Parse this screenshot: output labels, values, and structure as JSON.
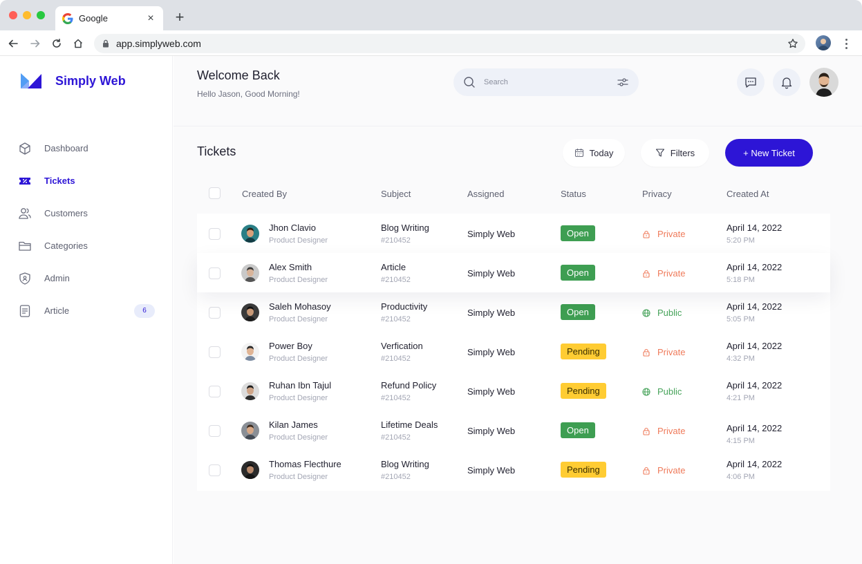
{
  "browser": {
    "tab_title": "Google",
    "tab_close": "×",
    "new_tab": "+",
    "url": "app.simplyweb.com"
  },
  "brand": {
    "name": "Simply Web"
  },
  "sidebar": {
    "items": [
      {
        "label": "Dashboard",
        "icon": "box-icon",
        "active": false
      },
      {
        "label": "Tickets",
        "icon": "ticket-icon",
        "active": true
      },
      {
        "label": "Customers",
        "icon": "users-icon",
        "active": false
      },
      {
        "label": "Categories",
        "icon": "folder-icon",
        "active": false
      },
      {
        "label": "Admin",
        "icon": "shield-user-icon",
        "active": false
      },
      {
        "label": "Article",
        "icon": "document-icon",
        "active": false,
        "badge": "6"
      }
    ]
  },
  "header": {
    "title": "Welcome Back",
    "greeting": "Hello Jason, Good Morning!",
    "search_placeholder": "Search"
  },
  "tickets": {
    "title": "Tickets",
    "today_label": "Today",
    "filters_label": "Filters",
    "new_ticket_label": "+ New Ticket",
    "columns": {
      "created_by": "Created By",
      "subject": "Subject",
      "assigned": "Assigned",
      "status": "Status",
      "privacy": "Privacy",
      "created_at": "Created At"
    },
    "rows": [
      {
        "name": "Jhon Clavio",
        "role": "Product Designer",
        "subject": "Blog Writing",
        "id": "#210452",
        "assigned": "Simply Web",
        "status": "Open",
        "privacy": "Private",
        "date": "April 14, 2022",
        "time": "5:20 PM"
      },
      {
        "name": "Alex Smith",
        "role": "Product Designer",
        "subject": "Article",
        "id": "#210452",
        "assigned": "Simply Web",
        "status": "Open",
        "privacy": "Private",
        "date": "April 14, 2022",
        "time": "5:18 PM"
      },
      {
        "name": "Saleh Mohasoy",
        "role": "Product Designer",
        "subject": "Productivity",
        "id": "#210452",
        "assigned": "Simply Web",
        "status": "Open",
        "privacy": "Public",
        "date": "April 14, 2022",
        "time": "5:05 PM"
      },
      {
        "name": "Power Boy",
        "role": "Product Designer",
        "subject": "Verfication",
        "id": "#210452",
        "assigned": "Simply Web",
        "status": "Pending",
        "privacy": "Private",
        "date": "April 14, 2022",
        "time": "4:32 PM"
      },
      {
        "name": "Ruhan Ibn Tajul",
        "role": "Product Designer",
        "subject": "Refund Policy",
        "id": "#210452",
        "assigned": "Simply Web",
        "status": "Pending",
        "privacy": "Public",
        "date": "April 14, 2022",
        "time": "4:21 PM"
      },
      {
        "name": "Kilan James",
        "role": "Product Designer",
        "subject": "Lifetime Deals",
        "id": "#210452",
        "assigned": "Simply Web",
        "status": "Open",
        "privacy": "Private",
        "date": "April 14, 2022",
        "time": "4:15 PM"
      },
      {
        "name": "Thomas Flecthure",
        "role": "Product Designer",
        "subject": "Blog Writing",
        "id": "#210452",
        "assigned": "Simply Web",
        "status": "Pending",
        "privacy": "Private",
        "date": "April 14, 2022",
        "time": "4:06 PM"
      }
    ]
  },
  "colors": {
    "brand": "#2d15d6",
    "open": "#3e9e52",
    "pending": "#ffcc33",
    "private": "#ef7a5a",
    "public": "#46a35a"
  }
}
